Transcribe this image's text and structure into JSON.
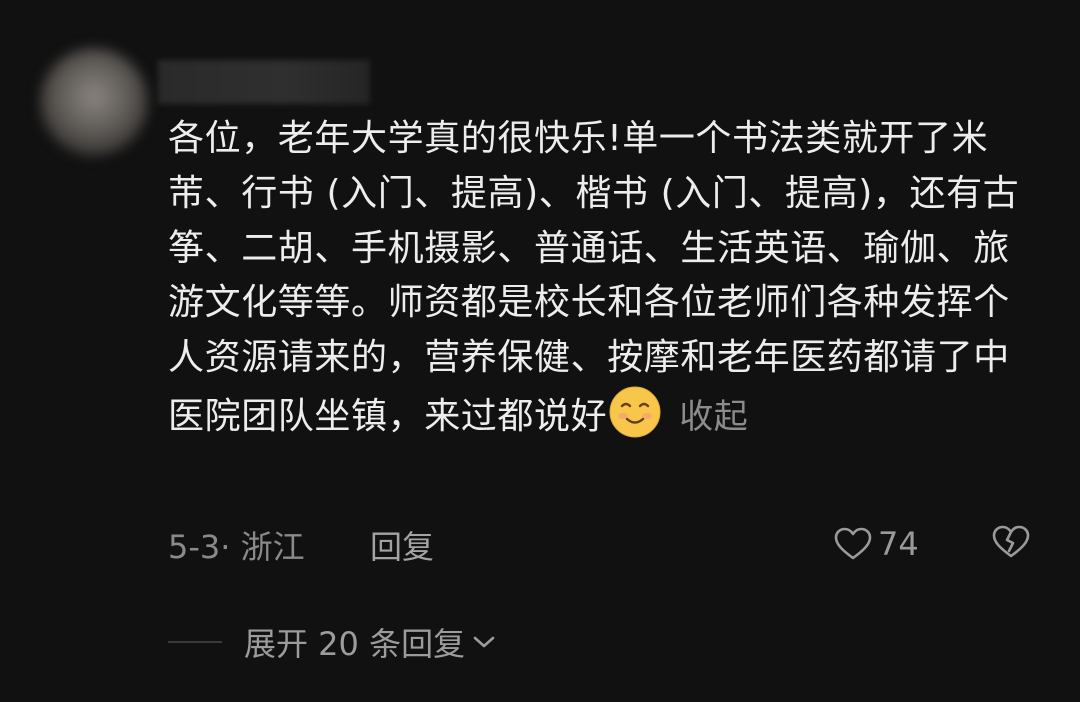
{
  "comment": {
    "text": "各位，老年大学真的很快乐!单一个书法类就开了米芾、行书 (入门、提高)、楷书 (入门、提高)，还有古筝、二胡、手机摄影、普通话、生活英语、瑜伽、旅游文化等等。师资都是校长和各位老师们各种发挥个人资源请来的，营养保健、按摩和老年医药都请了中医院团队坐镇，来过都说好",
    "emoji": "smiling-face-emoji",
    "collapse_label": "收起"
  },
  "meta": {
    "date_location": "5-3· 浙江",
    "reply_label": "回复",
    "like_count": "74",
    "like_icon": "heart-outline-icon",
    "dislike_icon": "broken-heart-icon"
  },
  "replies": {
    "expand_label": "展开 20 条回复",
    "expand_icon": "chevron-down-icon"
  },
  "colors": {
    "background": "#111111",
    "text": "#ededed",
    "muted": "#8c8c8c",
    "emoji_face": "#f7c64a"
  }
}
